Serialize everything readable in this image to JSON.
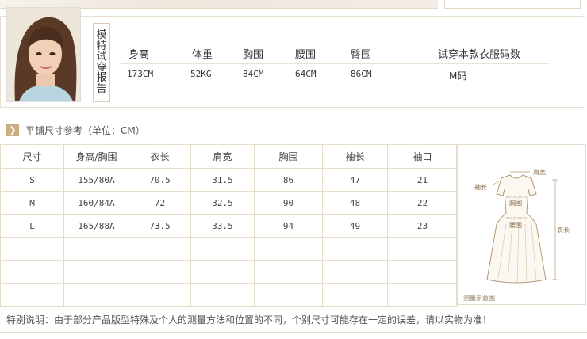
{
  "model_report": {
    "label_chars": [
      "模",
      "特",
      "试",
      "穿",
      "报",
      "告"
    ],
    "headers": [
      "身高",
      "体重",
      "胸围",
      "腰围",
      "臀围",
      "试穿本款衣服码数"
    ],
    "values": [
      "173CM",
      "52KG",
      "84CM",
      "64CM",
      "86CM",
      "M码"
    ]
  },
  "size_section": {
    "title": "平铺尺寸参考（单位：CM）",
    "columns": [
      "尺寸",
      "身高/胸围",
      "衣长",
      "肩宽",
      "胸围",
      "袖长",
      "袖口"
    ],
    "rows": [
      [
        "S",
        "155/80A",
        "70.5",
        "31.5",
        "86",
        "47",
        "21"
      ],
      [
        "M",
        "160/84A",
        "72",
        "32.5",
        "90",
        "48",
        "22"
      ],
      [
        "L",
        "165/88A",
        "73.5",
        "33.5",
        "94",
        "49",
        "23"
      ],
      [
        "",
        "",
        "",
        "",
        "",
        "",
        ""
      ],
      [
        "",
        "",
        "",
        "",
        "",
        "",
        ""
      ],
      [
        "",
        "",
        "",
        "",
        "",
        "",
        ""
      ]
    ]
  },
  "diagram": {
    "labels": {
      "shoulder": "肩宽",
      "sleeve": "袖长",
      "chest": "胸围",
      "waist": "腰围",
      "length": "衣长",
      "caption": "测量示意图"
    }
  },
  "footer_note": "特别说明：由于部分产品版型特殊及个人的测量方法和位置的不同，个别尺寸可能存在一定的误差，请以实物为准！",
  "colors": {
    "accent": "#c8ae80",
    "border": "#e6dccc",
    "diagram_line": "#b39a74"
  }
}
